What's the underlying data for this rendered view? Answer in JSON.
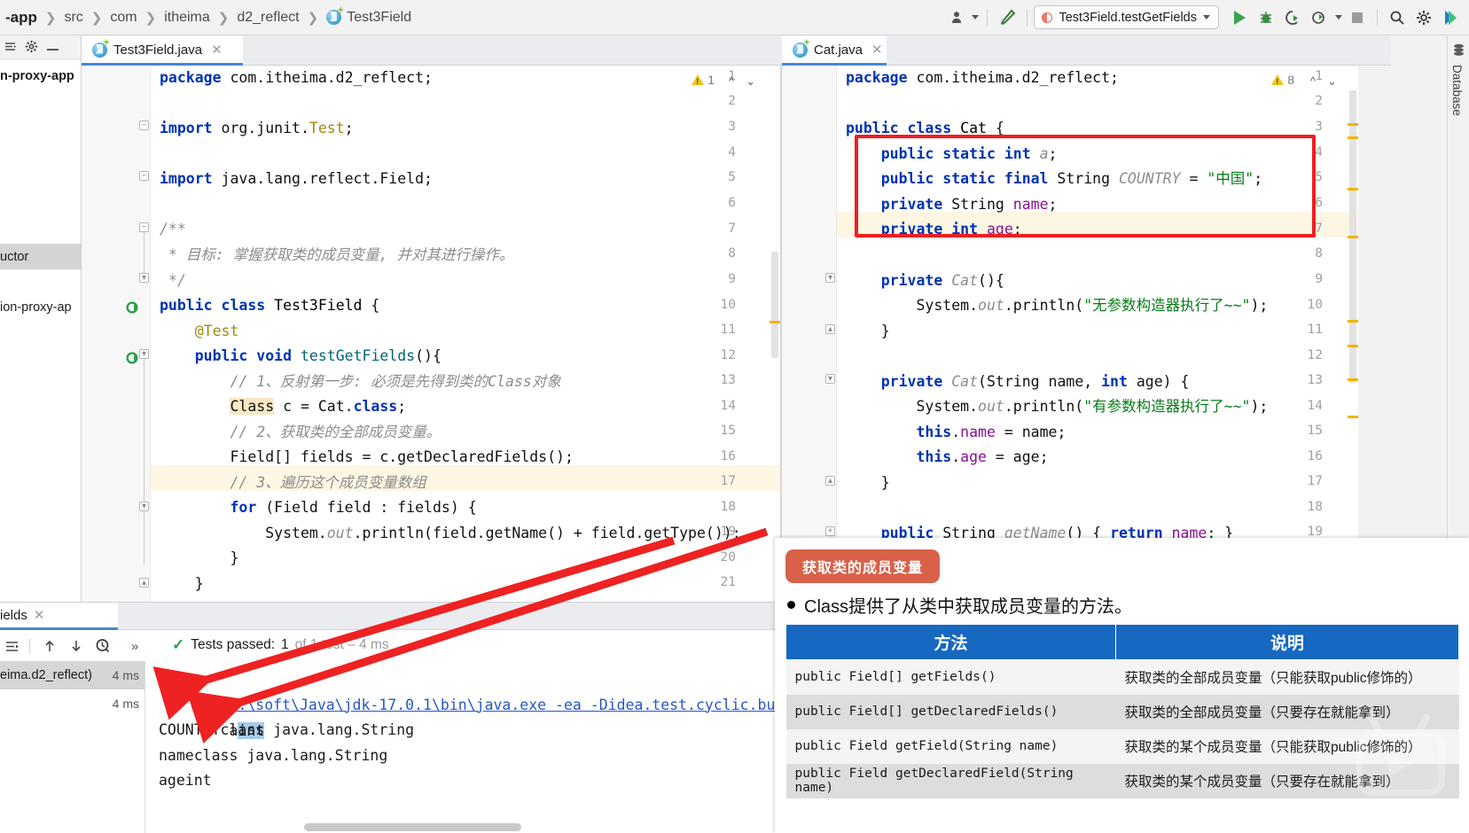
{
  "window": {
    "breadcrumb": [
      "-app",
      "src",
      "com",
      "itheima",
      "d2_reflect",
      "Test3Field"
    ],
    "run_config": "Test3Field.testGetFields",
    "right_tool_label": "Database"
  },
  "toolbar_icons": {
    "profile": "user-icon",
    "hammer": "build-icon",
    "run": "run-icon",
    "debug": "debug-icon",
    "run_coverage": "run-with-coverage-icon",
    "profiler": "profiler-icon",
    "stop": "stop-icon",
    "search": "search-icon",
    "settings": "gear-icon",
    "ide_logo": "ide-logo-icon"
  },
  "project_panel": {
    "rows": [
      "n-proxy-app",
      "uctor",
      "ion-proxy-ap"
    ]
  },
  "editor_tabs": [
    {
      "label": "Test3Field.java",
      "icon": "java-class-icon",
      "active": true
    },
    {
      "label": "Cat.java",
      "icon": "java-class-icon",
      "active": true
    }
  ],
  "left_editor": {
    "file": "Test3Field.java",
    "warning_count": "1",
    "first_line": 1,
    "highlight_line": 17,
    "lines": [
      "package com.itheima.d2_reflect;",
      "",
      "import org.junit.Test;",
      "",
      "import java.lang.reflect.Field;",
      "",
      "/**",
      " * 目标: 掌握获取类的成员变量, 并对其进行操作。",
      " */",
      "public class Test3Field {",
      "    @Test",
      "    public void testGetFields(){",
      "        // 1、反射第一步: 必须是先得到类的Class对象",
      "        Class c = Cat.class;",
      "        // 2、获取类的全部成员变量。",
      "        Field[] fields = c.getDeclaredFields();",
      "        // 3、遍历这个成员变量数组",
      "        for (Field field : fields) {",
      "            System.out.println(field.getName() + field.getType());",
      "        }",
      "    }",
      "}"
    ]
  },
  "right_editor": {
    "file": "Cat.java",
    "warning_count": "8",
    "highlight_line": 7,
    "lines": [
      "package com.itheima.d2_reflect;",
      "",
      "public class Cat {",
      "    public static int a;",
      "    public static final String COUNTRY = \"中国\";",
      "    private String name;",
      "    private int age;",
      "",
      "    private Cat(){",
      "        System.out.println(\"无参数构造器执行了~~\");",
      "    }",
      "",
      "    private Cat(String name, int age) {",
      "        System.out.println(\"有参数构造器执行了~~\");",
      "        this.name = name;",
      "        this.age = age;",
      "    }",
      "",
      "    public String getName() { return name; }"
    ]
  },
  "run_panel": {
    "tab_label": "ields",
    "status_passed": "Tests passed:",
    "status_count": "1",
    "status_rest": "of 1 test – 4 ms",
    "tree": [
      {
        "label": "eima.d2_reflect)",
        "time": "4 ms",
        "selected": true
      },
      {
        "label": "",
        "time": "4 ms",
        "selected": false
      }
    ],
    "console": [
      {
        "link": "D:\\soft\\Java\\jdk-17.0.1\\bin\\java.exe",
        "rest": " -ea -Didea.test.cyclic.buffer."
      },
      {
        "sel_prefix": "a",
        "sel": "int",
        "rest": ""
      },
      {
        "plain": "COUNTRYclass java.lang.String"
      },
      {
        "plain": "nameclass java.lang.String"
      },
      {
        "plain": "ageint"
      }
    ],
    "toolbar_icons": [
      "expand-collapse-icon",
      "up-arrow-icon",
      "down-arrow-icon",
      "history-icon",
      "more-icon"
    ]
  },
  "slide": {
    "badge": "获取类的成员变量",
    "bullet": "Class提供了从类中获取成员变量的方法。",
    "table": {
      "headers": [
        "方法",
        "说明"
      ],
      "rows": [
        [
          "public Field[] getFields()",
          "获取类的全部成员变量（只能获取public修饰的）"
        ],
        [
          "public Field[] getDeclaredFields()",
          "获取类的全部成员变量（只要存在就能拿到）"
        ],
        [
          "public Field getField(String name)",
          "获取类的某个成员变量（只能获取public修饰的）"
        ],
        [
          "public Field getDeclaredField(String name)",
          "获取类的某个成员变量（只要存在就能拿到）"
        ]
      ]
    },
    "watermark": "bilibili-play-icon"
  },
  "colors": {
    "accent_blue": "#4787d6",
    "table_header": "#1668c1",
    "badge_red": "#d9614a",
    "annotation_red": "#ee2222",
    "keyword": "#0033b3",
    "string": "#067d17",
    "comment": "#8c8c8c",
    "field": "#871094",
    "warning_yellow": "#f0c419",
    "pass_green": "#2e9e4f"
  }
}
